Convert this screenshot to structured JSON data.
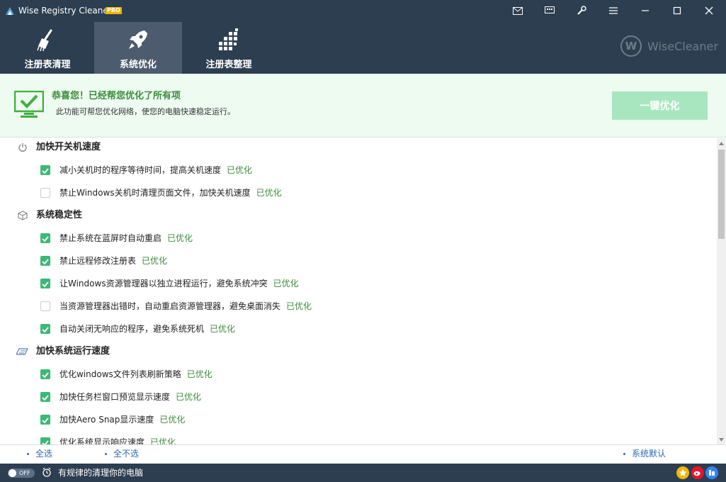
{
  "window": {
    "title": "Wise Registry Cleaner X",
    "badge": "PRO"
  },
  "titlebar_icons": [
    "mail-icon",
    "feedback-icon",
    "tools-icon",
    "menu-icon"
  ],
  "window_controls": [
    "minimize-icon",
    "maximize-icon",
    "close-icon"
  ],
  "tabs": [
    {
      "label": "注册表清理",
      "icon": "broom-icon",
      "active": false
    },
    {
      "label": "系统优化",
      "icon": "rocket-icon",
      "active": true
    },
    {
      "label": "注册表整理",
      "icon": "defrag-icon",
      "active": false
    }
  ],
  "brand": {
    "logo_letter": "W",
    "name": "WiseCleaner"
  },
  "banner": {
    "title": "恭喜您！已经帮您优化了所有项",
    "subtitle": "此功能可帮您优化网络，使您的电脑快速稳定运行。",
    "button_label": "一键优化",
    "icon": "monitor-check-icon"
  },
  "sections": [
    {
      "title": "加快开关机速度",
      "icon": "power-icon",
      "items": [
        {
          "text": "减小关机时的程序等待时间，提高关机速度",
          "status": "已优化",
          "checked": true
        },
        {
          "text": "禁止Windows关机时清理页面文件，加快关机速度",
          "status": "已优化",
          "checked": false
        }
      ]
    },
    {
      "title": "系统稳定性",
      "icon": "cube-icon",
      "items": [
        {
          "text": "禁止系统在蓝屏时自动重启",
          "status": "已优化",
          "checked": true
        },
        {
          "text": "禁止远程修改注册表",
          "status": "已优化",
          "checked": true
        },
        {
          "text": "让Windows资源管理器以独立进程运行，避免系统冲突",
          "status": "已优化",
          "checked": true
        },
        {
          "text": "当资源管理器出错时，自动重启资源管理器，避免桌面消失",
          "status": "已优化",
          "checked": false
        },
        {
          "text": "自动关闭无响应的程序，避免系统死机",
          "status": "已优化",
          "checked": true
        }
      ]
    },
    {
      "title": "加快系统运行速度",
      "icon": "speed-icon",
      "items": [
        {
          "text": "优化windows文件列表刷新策略",
          "status": "已优化",
          "checked": true
        },
        {
          "text": "加快任务栏窗口预览显示速度",
          "status": "已优化",
          "checked": true
        },
        {
          "text": "加快Aero Snap显示速度",
          "status": "已优化",
          "checked": true
        },
        {
          "text": "优化系统显示响应速度",
          "status": "已优化",
          "checked": true
        }
      ]
    }
  ],
  "footer": {
    "select_all": "全选",
    "select_none": "全不选",
    "system_default": "系统默认"
  },
  "statusbar": {
    "toggle_label": "OFF",
    "text": "有规律的清理你的电脑",
    "social": [
      {
        "name": "star-icon",
        "color": "#f2b705"
      },
      {
        "name": "weibo-icon",
        "color": "#e6162d"
      },
      {
        "name": "tieba-icon",
        "color": "#3385ff"
      }
    ]
  },
  "colors": {
    "header_bg": "#2c3e50",
    "active_tab_bg": "#4c5c6e",
    "banner_bg": "#eefbf1",
    "banner_title": "#3d8c3d",
    "optimize_button": "#a8e6c0",
    "checkbox_on": "#3cb878",
    "status_text": "#3a8a3a",
    "link": "#2a6ab0"
  }
}
